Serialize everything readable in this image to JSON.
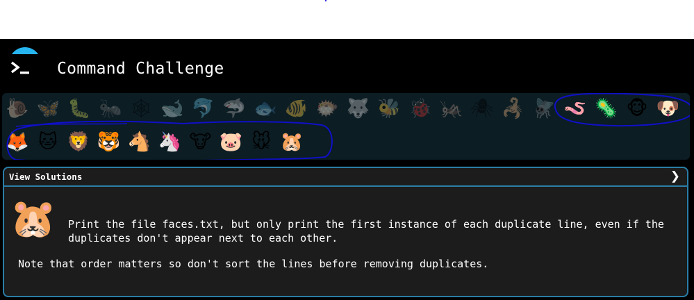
{
  "header": {
    "title": "Command Challenge",
    "logo_icon": "terminal-prompt-icon",
    "accent": "#26b5f0"
  },
  "challenges": {
    "row1": [
      {
        "name": "snail-icon",
        "glyph": "🐌",
        "state": "dim"
      },
      {
        "name": "butterfly-icon",
        "glyph": "🦋",
        "state": "dim"
      },
      {
        "name": "caterpillar-icon",
        "glyph": "🐛",
        "state": "dim"
      },
      {
        "name": "ant-icon",
        "glyph": "🐜",
        "state": "dim"
      },
      {
        "name": "spider-web-icon",
        "glyph": "🕸",
        "state": "dim"
      },
      {
        "name": "whale-icon",
        "glyph": "🐋",
        "state": "dim"
      },
      {
        "name": "dolphin-icon",
        "glyph": "🐬",
        "state": "dim"
      },
      {
        "name": "shark-icon",
        "glyph": "🦈",
        "state": "dim"
      },
      {
        "name": "fish-icon",
        "glyph": "🐟",
        "state": "dim"
      },
      {
        "name": "tropical-fish-icon",
        "glyph": "🐠",
        "state": "dim"
      },
      {
        "name": "pufferfish-icon",
        "glyph": "🐡",
        "state": "dim"
      },
      {
        "name": "wolf-icon",
        "glyph": "🐺",
        "state": "dim"
      },
      {
        "name": "bee-icon",
        "glyph": "🐝",
        "state": "dim"
      },
      {
        "name": "ladybug-icon",
        "glyph": "🐞",
        "state": "dim"
      },
      {
        "name": "cricket-icon",
        "glyph": "🦗",
        "state": "dim"
      },
      {
        "name": "spider-icon",
        "glyph": "🕷",
        "state": "dim"
      },
      {
        "name": "scorpion-icon",
        "glyph": "🦂",
        "state": "dim"
      },
      {
        "name": "fly-icon",
        "glyph": "🪰",
        "state": "dim"
      },
      {
        "name": "worm-icon",
        "glyph": "🪱",
        "state": "active"
      },
      {
        "name": "microbe-icon",
        "glyph": "🦠",
        "state": "active"
      },
      {
        "name": "monkey-icon",
        "glyph": "🐵",
        "state": "active"
      },
      {
        "name": "dog-icon",
        "glyph": "🐶",
        "state": "active"
      }
    ],
    "row2": [
      {
        "name": "fox-icon",
        "glyph": "🦊",
        "state": "active"
      },
      {
        "name": "cat-icon",
        "glyph": "🐱",
        "state": "active"
      },
      {
        "name": "lion-icon",
        "glyph": "🦁",
        "state": "active"
      },
      {
        "name": "tiger-icon",
        "glyph": "🐯",
        "state": "active"
      },
      {
        "name": "horse-icon",
        "glyph": "🐴",
        "state": "active"
      },
      {
        "name": "unicorn-icon",
        "glyph": "🦄",
        "state": "active"
      },
      {
        "name": "cow-icon",
        "glyph": "🐮",
        "state": "active"
      },
      {
        "name": "pig-icon",
        "glyph": "🐷",
        "state": "active"
      },
      {
        "name": "mouse-icon",
        "glyph": "🐭",
        "state": "active"
      },
      {
        "name": "hamster-icon",
        "glyph": "🐹",
        "state": "active"
      }
    ]
  },
  "panel": {
    "view_solutions": "View Solutions",
    "chevron_icon": "chevron-right-icon",
    "chevron_glyph": "❯",
    "current_icon": "hamster-icon",
    "current_glyph": "🐹",
    "description": "Print the file faces.txt, but only print the first instance of each duplicate line, even if the duplicates don't appear next to each other.",
    "note": "Note that order matters so don't sort the lines before removing duplicates."
  },
  "colors": {
    "background": "#000000",
    "icon_bar": "#0c1d24",
    "panel_bg": "#1c1c1c",
    "panel_border": "#2b7da6",
    "annotation": "#1010c8"
  }
}
